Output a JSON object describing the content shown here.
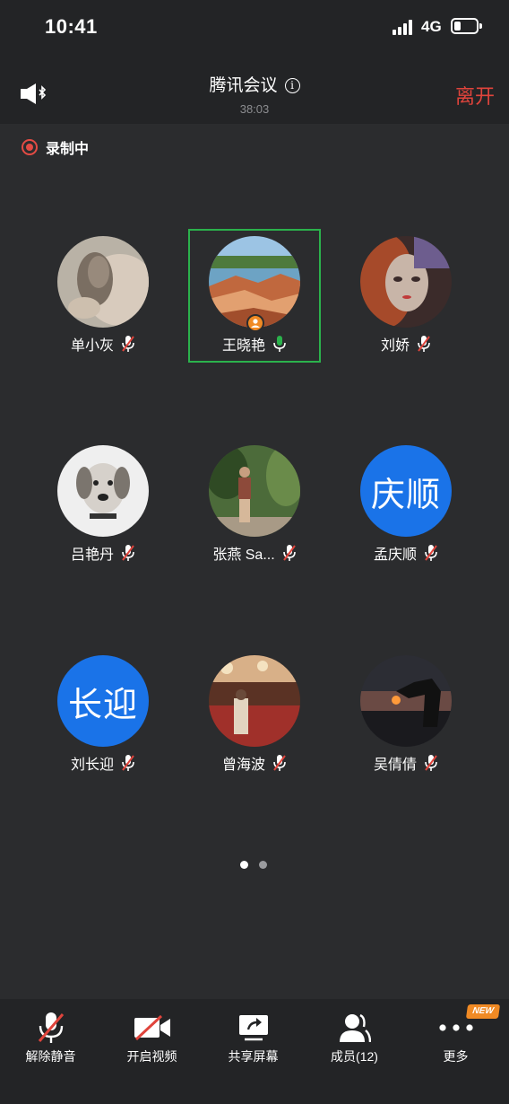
{
  "status_bar": {
    "time": "10:41",
    "network": "4G"
  },
  "header": {
    "title": "腾讯会议",
    "elapsed": "38:03",
    "leave_label": "离开"
  },
  "recording": {
    "label": "录制中"
  },
  "participants": [
    {
      "name": "单小灰",
      "muted": true
    },
    {
      "name": "王晓艳",
      "muted": false,
      "speaking": true
    },
    {
      "name": "刘娇",
      "muted": true
    },
    {
      "name": "吕艳丹",
      "muted": true
    },
    {
      "name": "张燕 Sa...",
      "muted": true
    },
    {
      "name": "孟庆顺",
      "muted": true,
      "avatar_text": "庆顺"
    },
    {
      "name": "刘长迎",
      "muted": true,
      "avatar_text": "长迎"
    },
    {
      "name": "曾海波",
      "muted": true
    },
    {
      "name": "吴倩倩",
      "muted": true
    }
  ],
  "pager": {
    "pages": 2,
    "current": 1
  },
  "toolbar": {
    "unmute": "解除静音",
    "start_video": "开启视频",
    "share_screen": "共享屏幕",
    "members": "成员(12)",
    "more": "更多",
    "new_badge": "NEW"
  },
  "colors": {
    "leave": "#e0443c",
    "speaking_frame": "#2bb24c",
    "text_avatar": "#1a73e8",
    "badge": "#f08a24"
  }
}
